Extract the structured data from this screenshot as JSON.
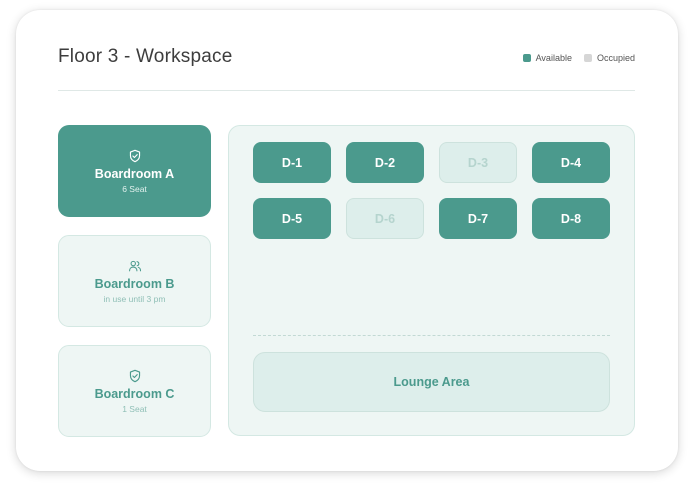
{
  "header": {
    "title": "Floor 3 - Workspace"
  },
  "legend": [
    {
      "label": "Available",
      "color": "#4b9a8d"
    },
    {
      "label": "Occupied",
      "color": "#d6d6d6"
    }
  ],
  "rooms": [
    {
      "name": "Boardroom A",
      "sub": "6 Seat",
      "status": "available",
      "icon": "shield-check-icon"
    },
    {
      "name": "Boardroom B",
      "sub": "in use until 3 pm",
      "status": "occupied",
      "icon": "users-icon"
    },
    {
      "name": "Boardroom C",
      "sub": "1 Seat",
      "status": "available",
      "icon": "shield-check-icon"
    }
  ],
  "desks": [
    {
      "label": "D-1",
      "status": "available"
    },
    {
      "label": "D-2",
      "status": "available"
    },
    {
      "label": "D-3",
      "status": "occupied"
    },
    {
      "label": "D-4",
      "status": "available"
    },
    {
      "label": "D-5",
      "status": "available"
    },
    {
      "label": "D-6",
      "status": "occupied"
    },
    {
      "label": "D-7",
      "status": "available"
    },
    {
      "label": "D-8",
      "status": "available"
    }
  ],
  "lounge": {
    "label": "Lounge Area"
  },
  "colors": {
    "accent": "#4b9a8d",
    "light_background": "#eef6f4",
    "occupied_fill": "#ddeeeb"
  }
}
